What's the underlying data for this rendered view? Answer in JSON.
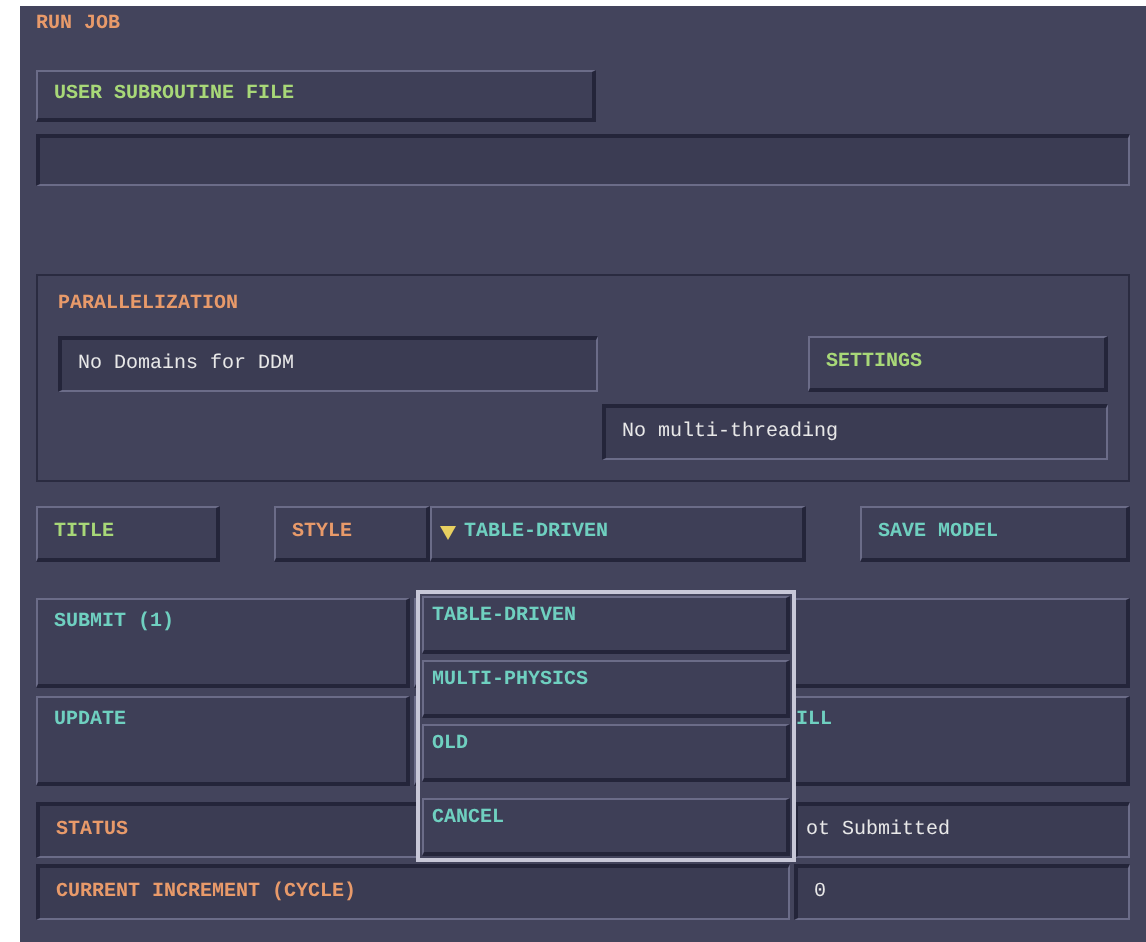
{
  "window": {
    "title": "RUN JOB"
  },
  "user_subroutine": {
    "button": "USER SUBROUTINE FILE"
  },
  "parallelization": {
    "title": "PARALLELIZATION",
    "domains": "No Domains for DDM",
    "settings_button": "SETTINGS",
    "threading": "No multi-threading"
  },
  "job_row": {
    "title_button": "TITLE",
    "style_label": "STYLE",
    "style_value": "TABLE-DRIVEN",
    "save_button": "SAVE MODEL"
  },
  "actions": [
    {
      "label": "SUBMIT (1)"
    },
    {
      "label": "UPDATE",
      "side": "ILL"
    }
  ],
  "status": {
    "label": "STATUS",
    "value": "ot Submitted"
  },
  "increment": {
    "label": "CURRENT INCREMENT (CYCLE)",
    "value": "0"
  },
  "style_menu": {
    "items": [
      {
        "label": "TABLE-DRIVEN",
        "kind": "option"
      },
      {
        "label": "MULTI-PHYSICS",
        "kind": "option"
      },
      {
        "label": "OLD",
        "kind": "option"
      },
      {
        "label": "CANCEL",
        "kind": "action"
      }
    ]
  }
}
